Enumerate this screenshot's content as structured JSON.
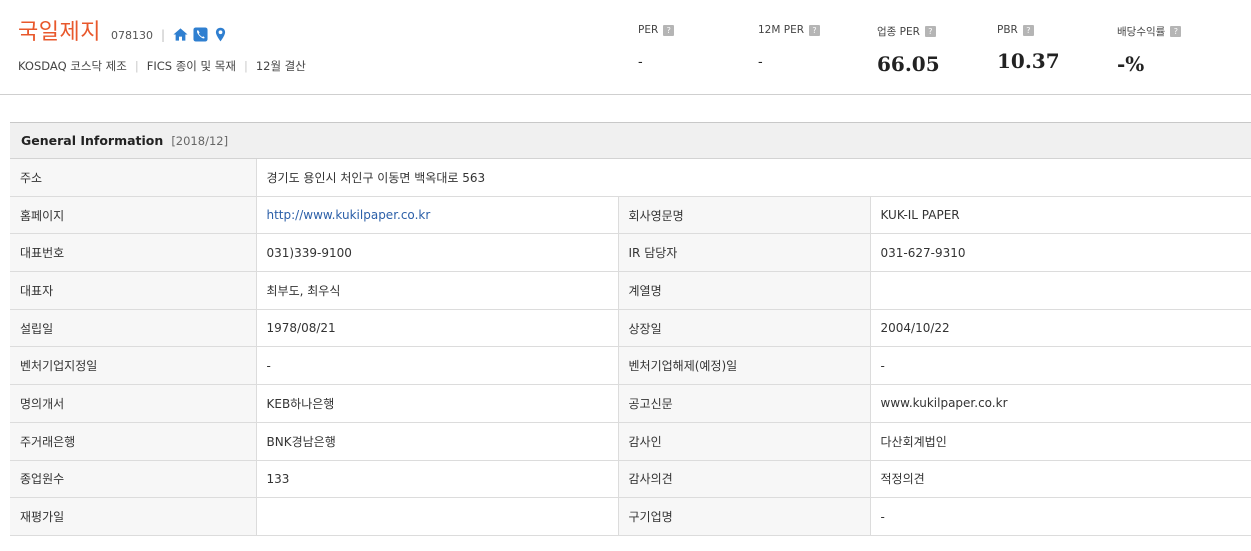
{
  "header": {
    "company_name": "국일제지",
    "stock_code": "078130",
    "separator": "|",
    "icons": [
      "home-icon",
      "phone-icon",
      "location-pin-icon"
    ],
    "market": "KOSDAQ 코스닥 제조",
    "fics": "FICS 종이 및 목재",
    "fiscal": "12월 결산",
    "colors": {
      "brand": "#e8582c",
      "icon_blue": "#2f7fd0"
    }
  },
  "metrics": [
    {
      "label": "PER",
      "value": "-"
    },
    {
      "label": "12M PER",
      "value": "-"
    },
    {
      "label": "업종 PER",
      "value": "66.05"
    },
    {
      "label": "PBR",
      "value": "10.37"
    },
    {
      "label": "배당수익률",
      "value": "-%"
    }
  ],
  "help_glyph": "?",
  "general": {
    "title": "General Information",
    "date": "[2018/12]",
    "address_label": "주소",
    "address_value": "경기도 용인시 처인구 이동면 백옥대로 563",
    "rows": [
      {
        "l1": "홈페이지",
        "v1": "http://www.kukilpaper.co.kr",
        "l2": "회사영문명",
        "v2": "KUK-IL PAPER"
      },
      {
        "l1": "대표번호",
        "v1": "031)339-9100",
        "l2": "IR 담당자",
        "v2": "031-627-9310"
      },
      {
        "l1": "대표자",
        "v1": "최부도, 최우식",
        "l2": "계열명",
        "v2": ""
      },
      {
        "l1": "설립일",
        "v1": "1978/08/21",
        "l2": "상장일",
        "v2": "2004/10/22"
      },
      {
        "l1": "벤처기업지정일",
        "v1": "-",
        "l2": "벤처기업해제(예정)일",
        "v2": "-"
      },
      {
        "l1": "명의개서",
        "v1": "KEB하나은행",
        "l2": "공고신문",
        "v2": "www.kukilpaper.co.kr"
      },
      {
        "l1": "주거래은행",
        "v1": "BNK경남은행",
        "l2": "감사인",
        "v2": "다산회계법인"
      },
      {
        "l1": "종업원수",
        "v1": "133",
        "l2": "감사의견",
        "v2": "적정의견"
      },
      {
        "l1": "재평가일",
        "v1": "",
        "l2": "구기업명",
        "v2": "-"
      }
    ]
  }
}
